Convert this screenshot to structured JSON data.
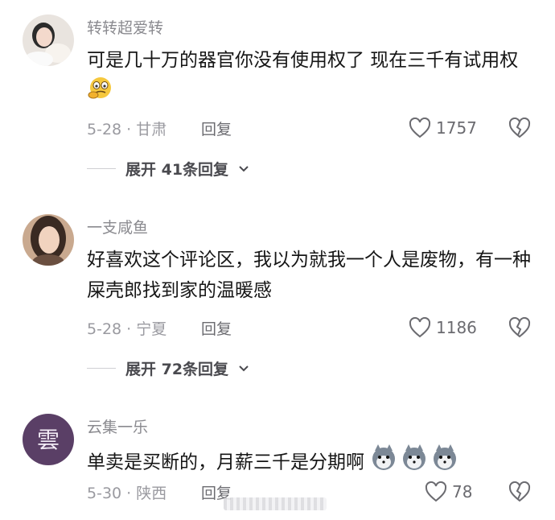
{
  "comments": [
    {
      "username": "转转超爱转",
      "text": "可是几十万的器官你没有使用权了 现在三千有试用权",
      "date_location": "5-28 · 甘肃",
      "reply_label": "回复",
      "likes": "1757",
      "expand_label": "展开 41条回复",
      "emoji_icon": "thinking-emoji-icon"
    },
    {
      "username": "一支咸鱼",
      "text": "好喜欢这个评论区，我以为就我一个人是废物，有一种屎壳郎找到家的温暖感",
      "date_location": "5-28 · 宁夏",
      "reply_label": "回复",
      "likes": "1186",
      "expand_label": "展开 72条回复"
    },
    {
      "username": "云集一乐",
      "text": "单卖是买断的，月薪三千是分期啊",
      "date_location": "5-30 · 陕西",
      "reply_label": "回复",
      "likes": "78",
      "emoji_icon": "husky-emoji-icon"
    }
  ],
  "colors": {
    "username": "#8a8a8f",
    "text": "#161616",
    "meta": "#9a9aa0"
  }
}
